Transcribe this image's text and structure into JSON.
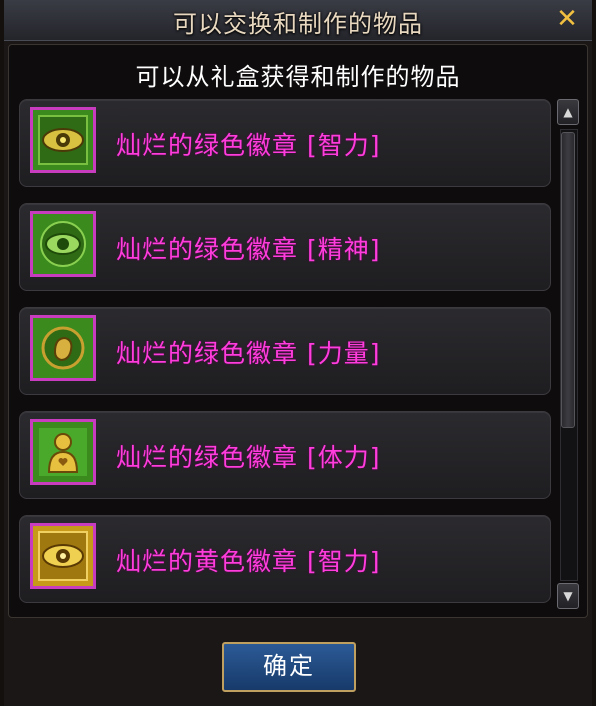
{
  "dialog": {
    "title": "可以交换和制作的物品",
    "close_glyph": "✕",
    "subtitle": "可以从礼盒获得和制作的物品",
    "confirm_label": "确定"
  },
  "items": [
    {
      "name": "灿烂的绿色徽章 [智力]",
      "icon": "eye-emblem-icon",
      "color": "#3a8a1e"
    },
    {
      "name": "灿烂的绿色徽章 [精神]",
      "icon": "spirit-eye-emblem-icon",
      "color": "#3a8a1e"
    },
    {
      "name": "灿烂的绿色徽章 [力量]",
      "icon": "fist-emblem-icon",
      "color": "#3a8a1e"
    },
    {
      "name": "灿烂的绿色徽章 [体力]",
      "icon": "body-emblem-icon",
      "color": "#3a8a1e"
    },
    {
      "name": "灿烂的黄色徽章 [智力]",
      "icon": "eye-emblem-icon",
      "color": "#c89a1a"
    }
  ],
  "scroll": {
    "up_glyph": "▲",
    "down_glyph": "▼"
  },
  "colors": {
    "item_name": "#ff3cdc",
    "icon_frame": "#c83cc0",
    "close": "#f2c040",
    "confirm_bg": "#1f4a82"
  }
}
